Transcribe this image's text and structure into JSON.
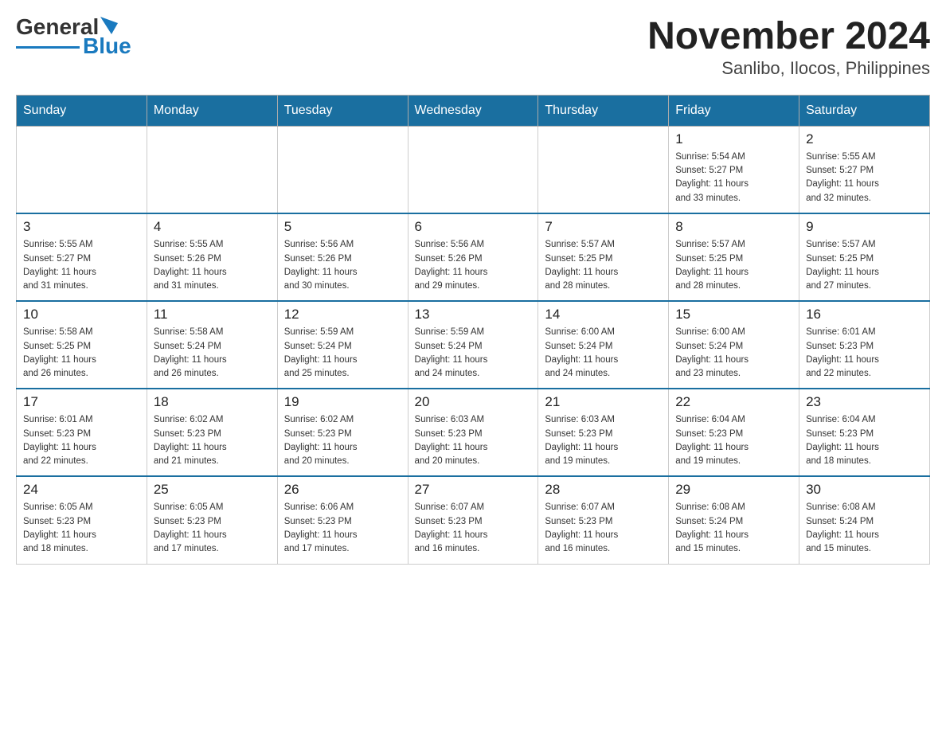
{
  "header": {
    "logo_general": "General",
    "logo_blue": "Blue",
    "month_title": "November 2024",
    "location": "Sanlibo, Ilocos, Philippines"
  },
  "days_of_week": [
    "Sunday",
    "Monday",
    "Tuesday",
    "Wednesday",
    "Thursday",
    "Friday",
    "Saturday"
  ],
  "weeks": [
    [
      {
        "day": "",
        "info": ""
      },
      {
        "day": "",
        "info": ""
      },
      {
        "day": "",
        "info": ""
      },
      {
        "day": "",
        "info": ""
      },
      {
        "day": "",
        "info": ""
      },
      {
        "day": "1",
        "info": "Sunrise: 5:54 AM\nSunset: 5:27 PM\nDaylight: 11 hours\nand 33 minutes."
      },
      {
        "day": "2",
        "info": "Sunrise: 5:55 AM\nSunset: 5:27 PM\nDaylight: 11 hours\nand 32 minutes."
      }
    ],
    [
      {
        "day": "3",
        "info": "Sunrise: 5:55 AM\nSunset: 5:27 PM\nDaylight: 11 hours\nand 31 minutes."
      },
      {
        "day": "4",
        "info": "Sunrise: 5:55 AM\nSunset: 5:26 PM\nDaylight: 11 hours\nand 31 minutes."
      },
      {
        "day": "5",
        "info": "Sunrise: 5:56 AM\nSunset: 5:26 PM\nDaylight: 11 hours\nand 30 minutes."
      },
      {
        "day": "6",
        "info": "Sunrise: 5:56 AM\nSunset: 5:26 PM\nDaylight: 11 hours\nand 29 minutes."
      },
      {
        "day": "7",
        "info": "Sunrise: 5:57 AM\nSunset: 5:25 PM\nDaylight: 11 hours\nand 28 minutes."
      },
      {
        "day": "8",
        "info": "Sunrise: 5:57 AM\nSunset: 5:25 PM\nDaylight: 11 hours\nand 28 minutes."
      },
      {
        "day": "9",
        "info": "Sunrise: 5:57 AM\nSunset: 5:25 PM\nDaylight: 11 hours\nand 27 minutes."
      }
    ],
    [
      {
        "day": "10",
        "info": "Sunrise: 5:58 AM\nSunset: 5:25 PM\nDaylight: 11 hours\nand 26 minutes."
      },
      {
        "day": "11",
        "info": "Sunrise: 5:58 AM\nSunset: 5:24 PM\nDaylight: 11 hours\nand 26 minutes."
      },
      {
        "day": "12",
        "info": "Sunrise: 5:59 AM\nSunset: 5:24 PM\nDaylight: 11 hours\nand 25 minutes."
      },
      {
        "day": "13",
        "info": "Sunrise: 5:59 AM\nSunset: 5:24 PM\nDaylight: 11 hours\nand 24 minutes."
      },
      {
        "day": "14",
        "info": "Sunrise: 6:00 AM\nSunset: 5:24 PM\nDaylight: 11 hours\nand 24 minutes."
      },
      {
        "day": "15",
        "info": "Sunrise: 6:00 AM\nSunset: 5:24 PM\nDaylight: 11 hours\nand 23 minutes."
      },
      {
        "day": "16",
        "info": "Sunrise: 6:01 AM\nSunset: 5:23 PM\nDaylight: 11 hours\nand 22 minutes."
      }
    ],
    [
      {
        "day": "17",
        "info": "Sunrise: 6:01 AM\nSunset: 5:23 PM\nDaylight: 11 hours\nand 22 minutes."
      },
      {
        "day": "18",
        "info": "Sunrise: 6:02 AM\nSunset: 5:23 PM\nDaylight: 11 hours\nand 21 minutes."
      },
      {
        "day": "19",
        "info": "Sunrise: 6:02 AM\nSunset: 5:23 PM\nDaylight: 11 hours\nand 20 minutes."
      },
      {
        "day": "20",
        "info": "Sunrise: 6:03 AM\nSunset: 5:23 PM\nDaylight: 11 hours\nand 20 minutes."
      },
      {
        "day": "21",
        "info": "Sunrise: 6:03 AM\nSunset: 5:23 PM\nDaylight: 11 hours\nand 19 minutes."
      },
      {
        "day": "22",
        "info": "Sunrise: 6:04 AM\nSunset: 5:23 PM\nDaylight: 11 hours\nand 19 minutes."
      },
      {
        "day": "23",
        "info": "Sunrise: 6:04 AM\nSunset: 5:23 PM\nDaylight: 11 hours\nand 18 minutes."
      }
    ],
    [
      {
        "day": "24",
        "info": "Sunrise: 6:05 AM\nSunset: 5:23 PM\nDaylight: 11 hours\nand 18 minutes."
      },
      {
        "day": "25",
        "info": "Sunrise: 6:05 AM\nSunset: 5:23 PM\nDaylight: 11 hours\nand 17 minutes."
      },
      {
        "day": "26",
        "info": "Sunrise: 6:06 AM\nSunset: 5:23 PM\nDaylight: 11 hours\nand 17 minutes."
      },
      {
        "day": "27",
        "info": "Sunrise: 6:07 AM\nSunset: 5:23 PM\nDaylight: 11 hours\nand 16 minutes."
      },
      {
        "day": "28",
        "info": "Sunrise: 6:07 AM\nSunset: 5:23 PM\nDaylight: 11 hours\nand 16 minutes."
      },
      {
        "day": "29",
        "info": "Sunrise: 6:08 AM\nSunset: 5:24 PM\nDaylight: 11 hours\nand 15 minutes."
      },
      {
        "day": "30",
        "info": "Sunrise: 6:08 AM\nSunset: 5:24 PM\nDaylight: 11 hours\nand 15 minutes."
      }
    ]
  ]
}
